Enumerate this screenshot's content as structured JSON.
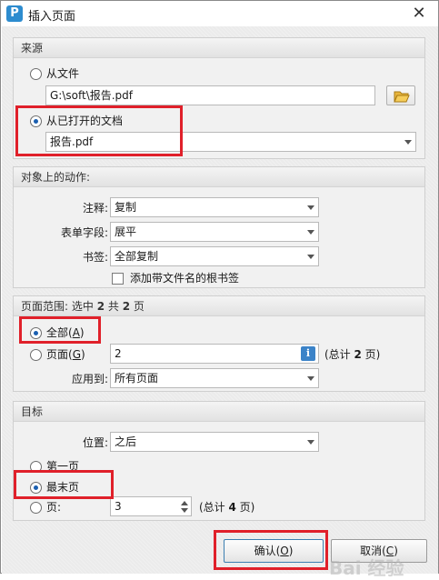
{
  "window": {
    "title": "插入页面",
    "close_glyph": "✕",
    "app_icon_letter": "P"
  },
  "source": {
    "header": "来源",
    "from_file_label": "从文件",
    "file_path": "G:\\soft\\报告.pdf",
    "from_open_label": "从已打开的文档",
    "open_doc_value": "报告.pdf",
    "selected": "from_open"
  },
  "actions": {
    "header": "对象上的动作:",
    "annot_label": "注释:",
    "annot_value": "复制",
    "form_label": "表单字段:",
    "form_value": "展平",
    "bookmark_label": "书签:",
    "bookmark_value": "全部复制",
    "add_bookmark_label": "添加带文件名的根书签",
    "add_bookmark_checked": false
  },
  "range": {
    "header_prefix": "页面范围: 选中 ",
    "header_selected": "2",
    "header_mid": " 共 ",
    "header_total": "2",
    "header_suffix": " 页",
    "all_label": "全部(",
    "all_key": "A",
    "all_close": ")",
    "pages_label": "页面(",
    "pages_key": "G",
    "pages_close": ")",
    "pages_value": "2",
    "info_glyph": "i",
    "total_prefix": "(总计 ",
    "total_num": "2",
    "total_suffix": " 页)",
    "apply_label": "应用到:",
    "apply_value": "所有页面",
    "selected": "all"
  },
  "target": {
    "header": "目标",
    "position_label": "位置:",
    "position_value": "之后",
    "first_label": "第一页",
    "last_label": "最末页",
    "page_label": "页:",
    "page_value": "3",
    "total_prefix": "(总计 ",
    "total_num": "4",
    "total_suffix": " 页)",
    "selected": "last"
  },
  "buttons": {
    "ok_label": "确认(",
    "ok_key": "O",
    "ok_close": ")",
    "cancel_label": "取消(",
    "cancel_key": "C",
    "cancel_close": ")"
  },
  "watermark": "Bai 经验",
  "colors": {
    "highlight": "#e0202a",
    "radio_dot": "#1b5fb0",
    "info": "#3b83c8"
  }
}
